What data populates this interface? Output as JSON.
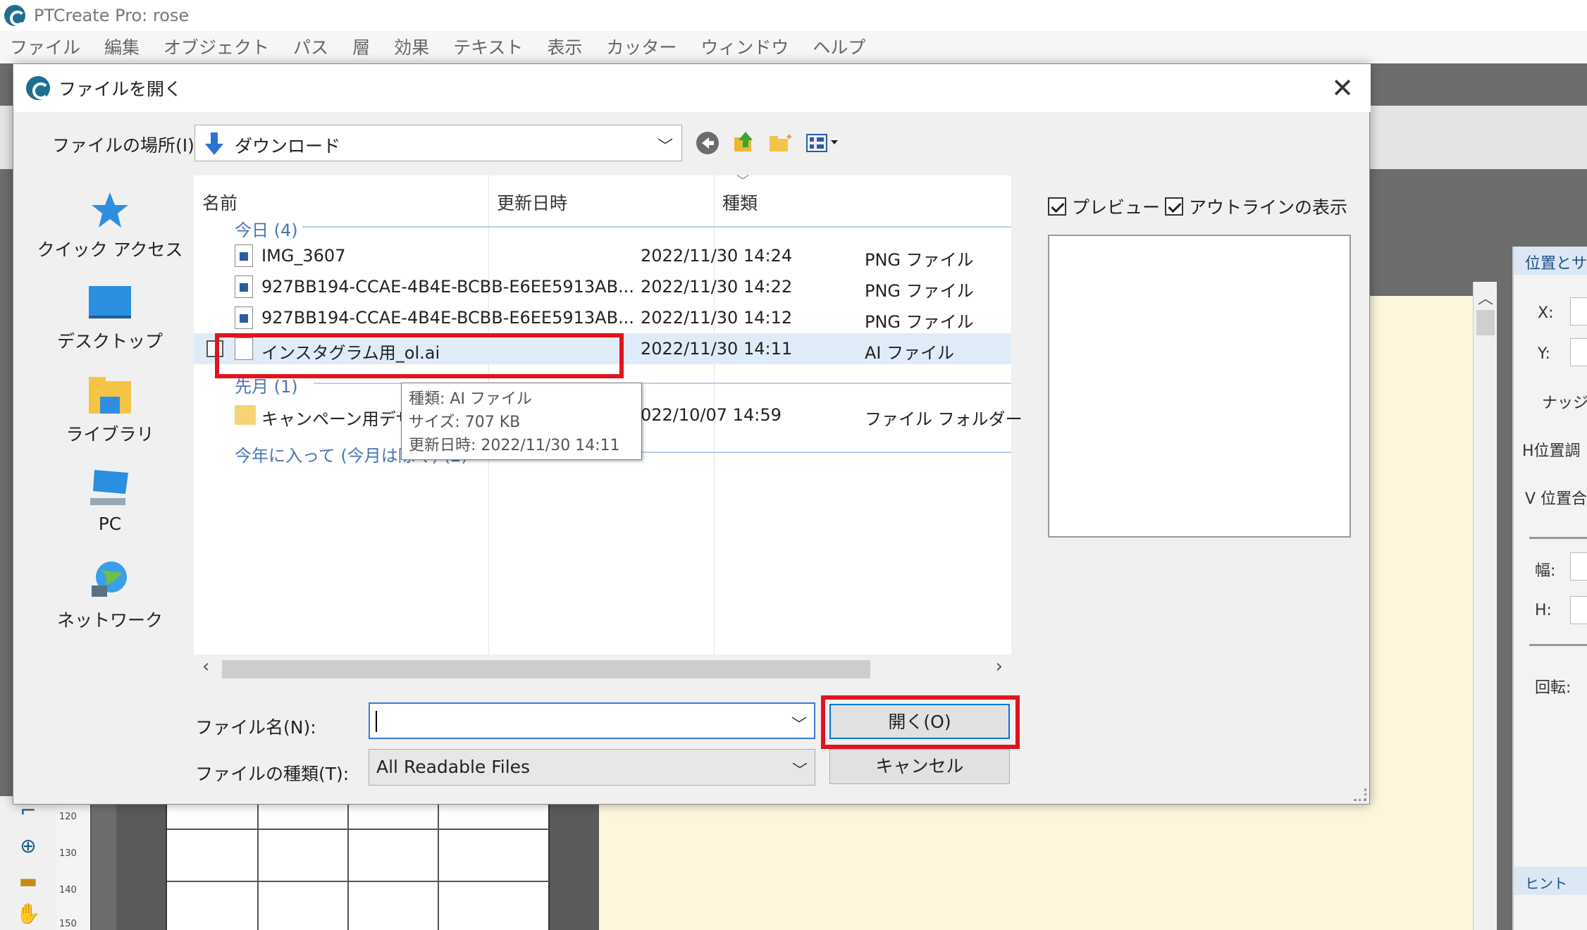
{
  "app": {
    "title": "PTCreate Pro: rose",
    "menu": [
      "ファイル",
      "編集",
      "オブジェクト",
      "パス",
      "層",
      "効果",
      "テキスト",
      "表示",
      "カッター",
      "ウィンドウ",
      "ヘルプ"
    ]
  },
  "dialog": {
    "title": "ファイルを開く",
    "location_label": "ファイルの場所(I):",
    "location_value": "ダウンロード",
    "places": [
      "クイック アクセス",
      "デスクトップ",
      "ライブラリ",
      "PC",
      "ネットワーク"
    ],
    "columns": {
      "name": "名前",
      "modified": "更新日時",
      "type": "種類"
    },
    "groups": {
      "today": "今日 (4)",
      "last_month": "先月 (1)",
      "this_year": "今年に入って (今月は除く) (2)"
    },
    "files": [
      {
        "name": "IMG_3607",
        "modified": "2022/11/30 14:24",
        "type": "PNG ファイル"
      },
      {
        "name": "927BB194-CCAE-4B4E-BCBB-E6EE5913AB...",
        "modified": "2022/11/30 14:22",
        "type": "PNG ファイル"
      },
      {
        "name": "927BB194-CCAE-4B4E-BCBB-E6EE5913AB...",
        "modified": "2022/11/30 14:12",
        "type": "PNG ファイル"
      },
      {
        "name": "インスタグラム用_ol.ai",
        "modified": "2022/11/30 14:11",
        "type": "AI ファイル"
      },
      {
        "name": "キャンペーン用デザイ",
        "modified": "022/10/07 14:59",
        "type": "ファイル フォルダー"
      }
    ],
    "tooltip": {
      "type": "種類: AI ファイル",
      "size": "サイズ: 707 KB",
      "modified": "更新日時: 2022/11/30 14:11"
    },
    "preview_label": "プレビュー",
    "outline_label": "アウトラインの表示",
    "filename_label": "ファイル名(N):",
    "filename_value": "",
    "filetype_label": "ファイルの種類(T):",
    "filetype_value": "All Readable Files",
    "open_button": "開く(O)",
    "cancel_button": "キャンセル"
  },
  "right_panel": {
    "header": "位置とサ",
    "x_label": "X:",
    "y_label": "Y:",
    "nudge_label": "ナッジ:",
    "h_align_label": "H位置調",
    "v_align_label": "V 位置合",
    "width_label": "幅:",
    "height_label": "H:",
    "rotate_label": "回転:",
    "hint_label": "ヒント"
  },
  "ruler": [
    "120",
    "130",
    "140",
    "150"
  ],
  "colors": {
    "highlight": "#e0141e",
    "accent": "#0078d7",
    "group_text": "#4a76b4"
  }
}
